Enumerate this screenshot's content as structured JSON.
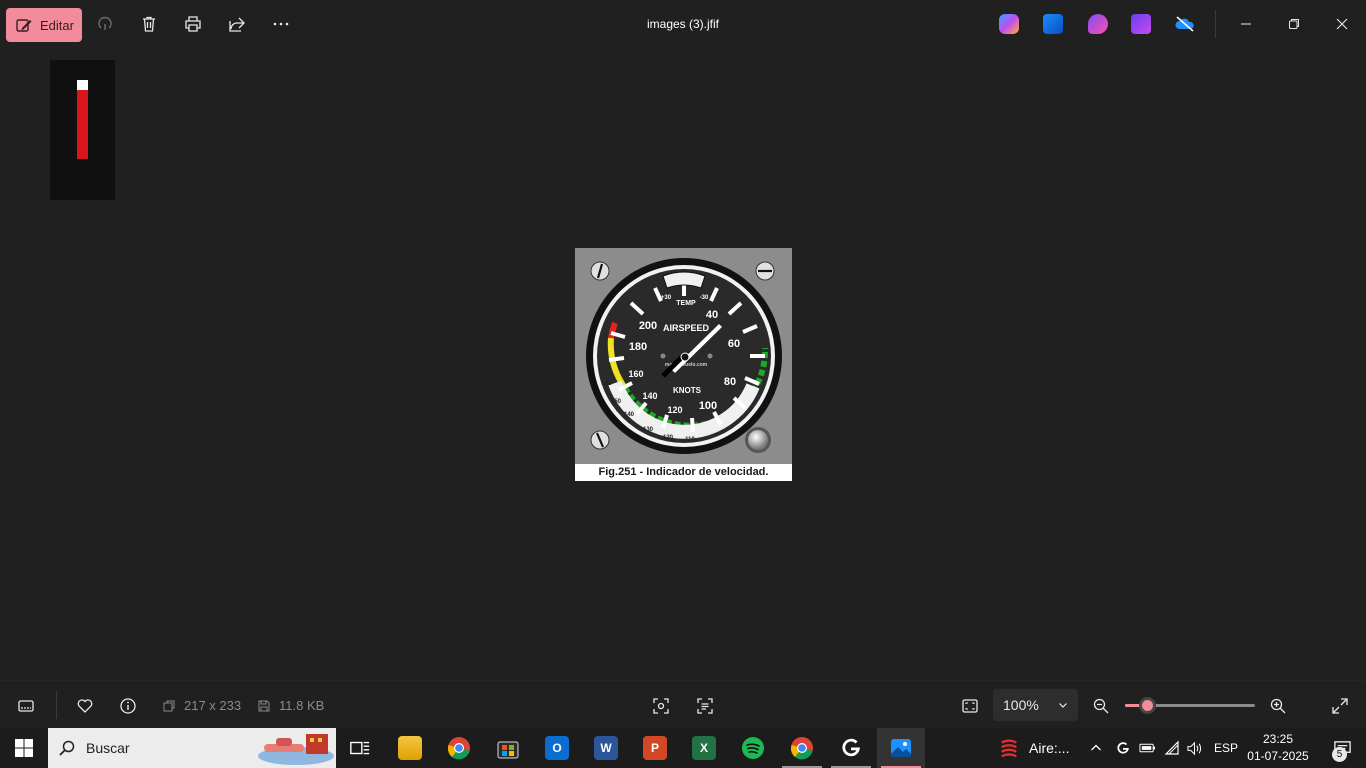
{
  "toolbar": {
    "edit_label": "Editar",
    "edit_icon": "edit-image-icon",
    "actions": [
      "rotate-icon",
      "delete-icon",
      "print-icon",
      "share-icon",
      "more-icon"
    ]
  },
  "window": {
    "title": "images (3).jfif"
  },
  "image": {
    "caption": "Fig.251 - Indicador de velocidad.",
    "gauge": {
      "label_top": "AIRSPEED",
      "label_bottom": "KNOTS",
      "label_temp": "TEMP",
      "temp_plus": "+30",
      "temp_minus": "-30",
      "watermark": "manualvuelo.com",
      "outer_marks": [
        "200",
        "40",
        "180",
        "60",
        "160",
        "80",
        "140",
        "100",
        "120"
      ],
      "inner_marks": [
        "160",
        "150",
        "140",
        "130",
        "120",
        "110"
      ]
    }
  },
  "info": {
    "dimensions": "217 x 233",
    "file_size": "11.8 KB",
    "zoom": "100%",
    "zoom_fraction": 0.17
  },
  "taskbar": {
    "search_placeholder": "Buscar",
    "weather_text": "Aire:...",
    "language": "ESP",
    "time": "23:25",
    "date": "01-07-2025",
    "notification_count": "5"
  },
  "colors": {
    "accent": "#f28b9a",
    "background": "#202020",
    "taskbar": "#1c1c1c"
  }
}
